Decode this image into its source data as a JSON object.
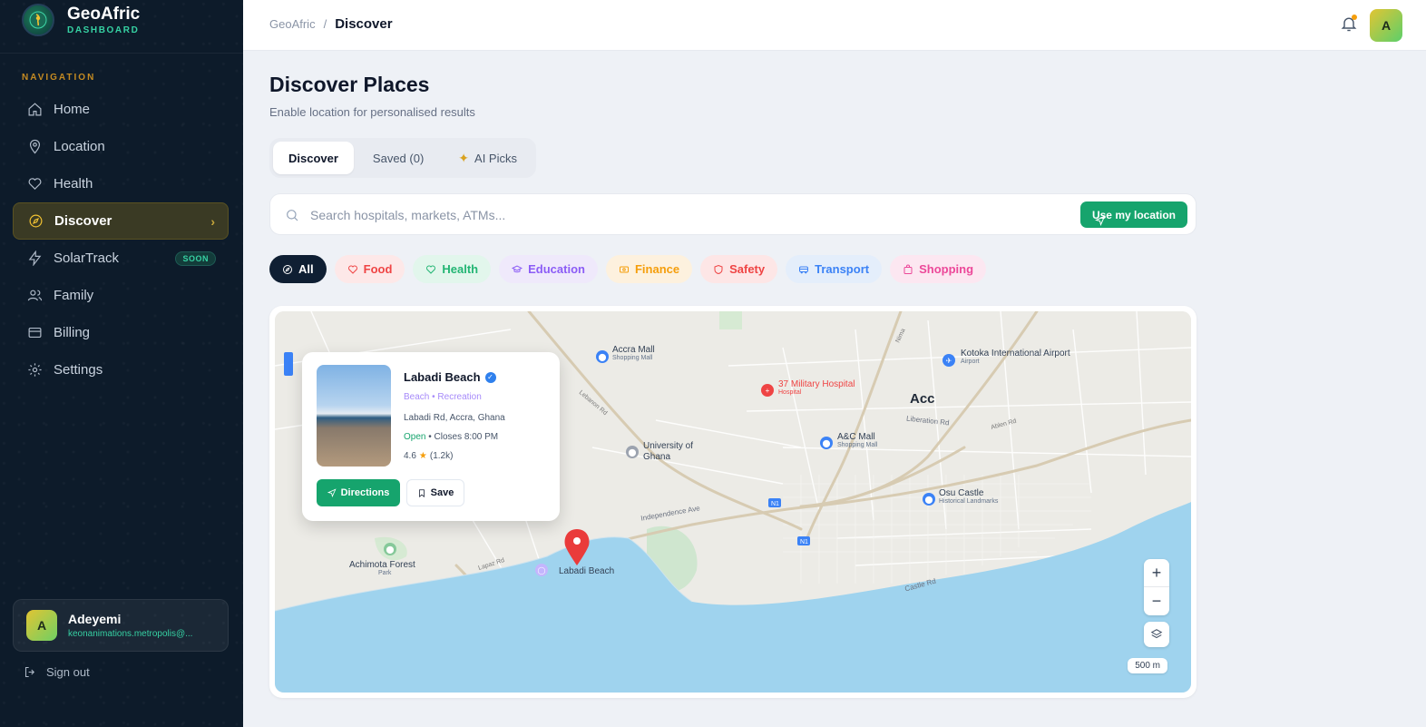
{
  "brand": {
    "title": "GeoAfric",
    "subtitle": "DASHBOARD"
  },
  "sidebar": {
    "section_label": "NAVIGATION",
    "items": [
      {
        "label": "Home",
        "icon": "home-icon"
      },
      {
        "label": "Location",
        "icon": "map-pin-icon"
      },
      {
        "label": "Health",
        "icon": "heart-icon"
      },
      {
        "label": "Discover",
        "icon": "compass-icon",
        "active": true
      },
      {
        "label": "SolarTrack",
        "icon": "bolt-icon",
        "badge": "SOON"
      },
      {
        "label": "Family",
        "icon": "users-icon"
      },
      {
        "label": "Billing",
        "icon": "credit-card-icon"
      },
      {
        "label": "Settings",
        "icon": "gear-icon"
      }
    ],
    "user": {
      "initial": "A",
      "name": "Adeyemi",
      "email": "keonanimations.metropolis@..."
    },
    "signout": "Sign out"
  },
  "topbar": {
    "breadcrumb_root": "GeoAfric",
    "breadcrumb_sep": "/",
    "breadcrumb_current": "Discover",
    "avatar_initial": "A"
  },
  "main": {
    "title": "Discover Places",
    "subtitle": "Enable location for personalised results",
    "tabs": [
      {
        "label": "Discover",
        "active": true
      },
      {
        "label": "Saved (0)"
      },
      {
        "label": "AI Picks",
        "icon": "sparkle-icon"
      }
    ],
    "search": {
      "placeholder": "Search hospitals, markets, ATMs...",
      "value": ""
    },
    "location_button": "Use my location",
    "filters": [
      {
        "label": "All",
        "color": "#ffffff",
        "bg": "#0f1f33"
      },
      {
        "label": "Food",
        "color": "#ef4444",
        "bg": "#fde8e8"
      },
      {
        "label": "Health",
        "color": "#22b573",
        "bg": "#e2f6ec"
      },
      {
        "label": "Education",
        "color": "#8b5cf6",
        "bg": "#efe9fb"
      },
      {
        "label": "Finance",
        "color": "#f59e0b",
        "bg": "#fdf1de"
      },
      {
        "label": "Safety",
        "color": "#ef4444",
        "bg": "#fde6e6"
      },
      {
        "label": "Transport",
        "color": "#3b82f6",
        "bg": "#e4eefb"
      },
      {
        "label": "Shopping",
        "color": "#ec4899",
        "bg": "#fce7f1"
      }
    ]
  },
  "map": {
    "labels": {
      "accra_mall": "Accra Mall",
      "accra_mall_sub": "Shopping Mall",
      "kotoka": "Kotoka International Airport",
      "kotoka_sub": "Airport",
      "military": "37 Military Hospital",
      "military_sub": "Hospital",
      "acc": "Acc",
      "acmall": "A&C Mall",
      "acmall_sub": "Shopping Mall",
      "university": "University of Ghana",
      "osu": "Osu Castle",
      "osu_sub": "Historical Landmarks",
      "achimota": "Achimota Forest",
      "achimota_sub": "Park",
      "labadi_pin": "Labadi Beach",
      "independence": "Independence Ave",
      "castle_rd": "Castle Rd",
      "liberation_rd": "Liberation Rd"
    },
    "zoom_in": "+",
    "zoom_out": "−",
    "scale": "500 m"
  },
  "place_card": {
    "name": "Labadi Beach",
    "category": "Beach • Recreation",
    "address": "Labadi Rd, Accra, Ghana",
    "open": "Open",
    "closes": "• Closes 8:00 PM",
    "rating": "4.6",
    "reviews": "(1.2k)",
    "directions": "Directions",
    "save": "Save"
  }
}
